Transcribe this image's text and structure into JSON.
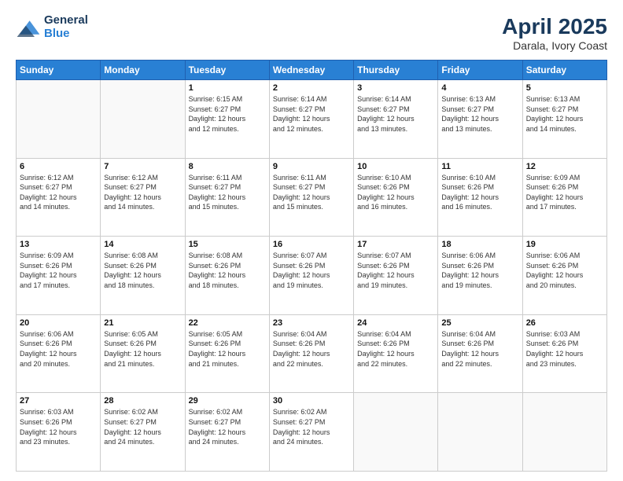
{
  "header": {
    "logo": {
      "general": "General",
      "blue": "Blue"
    },
    "month": "April 2025",
    "location": "Darala, Ivory Coast"
  },
  "weekdays": [
    "Sunday",
    "Monday",
    "Tuesday",
    "Wednesday",
    "Thursday",
    "Friday",
    "Saturday"
  ],
  "weeks": [
    [
      {
        "day": "",
        "info": ""
      },
      {
        "day": "",
        "info": ""
      },
      {
        "day": "1",
        "info": "Sunrise: 6:15 AM\nSunset: 6:27 PM\nDaylight: 12 hours\nand 12 minutes."
      },
      {
        "day": "2",
        "info": "Sunrise: 6:14 AM\nSunset: 6:27 PM\nDaylight: 12 hours\nand 12 minutes."
      },
      {
        "day": "3",
        "info": "Sunrise: 6:14 AM\nSunset: 6:27 PM\nDaylight: 12 hours\nand 13 minutes."
      },
      {
        "day": "4",
        "info": "Sunrise: 6:13 AM\nSunset: 6:27 PM\nDaylight: 12 hours\nand 13 minutes."
      },
      {
        "day": "5",
        "info": "Sunrise: 6:13 AM\nSunset: 6:27 PM\nDaylight: 12 hours\nand 14 minutes."
      }
    ],
    [
      {
        "day": "6",
        "info": "Sunrise: 6:12 AM\nSunset: 6:27 PM\nDaylight: 12 hours\nand 14 minutes."
      },
      {
        "day": "7",
        "info": "Sunrise: 6:12 AM\nSunset: 6:27 PM\nDaylight: 12 hours\nand 14 minutes."
      },
      {
        "day": "8",
        "info": "Sunrise: 6:11 AM\nSunset: 6:27 PM\nDaylight: 12 hours\nand 15 minutes."
      },
      {
        "day": "9",
        "info": "Sunrise: 6:11 AM\nSunset: 6:27 PM\nDaylight: 12 hours\nand 15 minutes."
      },
      {
        "day": "10",
        "info": "Sunrise: 6:10 AM\nSunset: 6:26 PM\nDaylight: 12 hours\nand 16 minutes."
      },
      {
        "day": "11",
        "info": "Sunrise: 6:10 AM\nSunset: 6:26 PM\nDaylight: 12 hours\nand 16 minutes."
      },
      {
        "day": "12",
        "info": "Sunrise: 6:09 AM\nSunset: 6:26 PM\nDaylight: 12 hours\nand 17 minutes."
      }
    ],
    [
      {
        "day": "13",
        "info": "Sunrise: 6:09 AM\nSunset: 6:26 PM\nDaylight: 12 hours\nand 17 minutes."
      },
      {
        "day": "14",
        "info": "Sunrise: 6:08 AM\nSunset: 6:26 PM\nDaylight: 12 hours\nand 18 minutes."
      },
      {
        "day": "15",
        "info": "Sunrise: 6:08 AM\nSunset: 6:26 PM\nDaylight: 12 hours\nand 18 minutes."
      },
      {
        "day": "16",
        "info": "Sunrise: 6:07 AM\nSunset: 6:26 PM\nDaylight: 12 hours\nand 19 minutes."
      },
      {
        "day": "17",
        "info": "Sunrise: 6:07 AM\nSunset: 6:26 PM\nDaylight: 12 hours\nand 19 minutes."
      },
      {
        "day": "18",
        "info": "Sunrise: 6:06 AM\nSunset: 6:26 PM\nDaylight: 12 hours\nand 19 minutes."
      },
      {
        "day": "19",
        "info": "Sunrise: 6:06 AM\nSunset: 6:26 PM\nDaylight: 12 hours\nand 20 minutes."
      }
    ],
    [
      {
        "day": "20",
        "info": "Sunrise: 6:06 AM\nSunset: 6:26 PM\nDaylight: 12 hours\nand 20 minutes."
      },
      {
        "day": "21",
        "info": "Sunrise: 6:05 AM\nSunset: 6:26 PM\nDaylight: 12 hours\nand 21 minutes."
      },
      {
        "day": "22",
        "info": "Sunrise: 6:05 AM\nSunset: 6:26 PM\nDaylight: 12 hours\nand 21 minutes."
      },
      {
        "day": "23",
        "info": "Sunrise: 6:04 AM\nSunset: 6:26 PM\nDaylight: 12 hours\nand 22 minutes."
      },
      {
        "day": "24",
        "info": "Sunrise: 6:04 AM\nSunset: 6:26 PM\nDaylight: 12 hours\nand 22 minutes."
      },
      {
        "day": "25",
        "info": "Sunrise: 6:04 AM\nSunset: 6:26 PM\nDaylight: 12 hours\nand 22 minutes."
      },
      {
        "day": "26",
        "info": "Sunrise: 6:03 AM\nSunset: 6:26 PM\nDaylight: 12 hours\nand 23 minutes."
      }
    ],
    [
      {
        "day": "27",
        "info": "Sunrise: 6:03 AM\nSunset: 6:26 PM\nDaylight: 12 hours\nand 23 minutes."
      },
      {
        "day": "28",
        "info": "Sunrise: 6:02 AM\nSunset: 6:27 PM\nDaylight: 12 hours\nand 24 minutes."
      },
      {
        "day": "29",
        "info": "Sunrise: 6:02 AM\nSunset: 6:27 PM\nDaylight: 12 hours\nand 24 minutes."
      },
      {
        "day": "30",
        "info": "Sunrise: 6:02 AM\nSunset: 6:27 PM\nDaylight: 12 hours\nand 24 minutes."
      },
      {
        "day": "",
        "info": ""
      },
      {
        "day": "",
        "info": ""
      },
      {
        "day": "",
        "info": ""
      }
    ]
  ]
}
